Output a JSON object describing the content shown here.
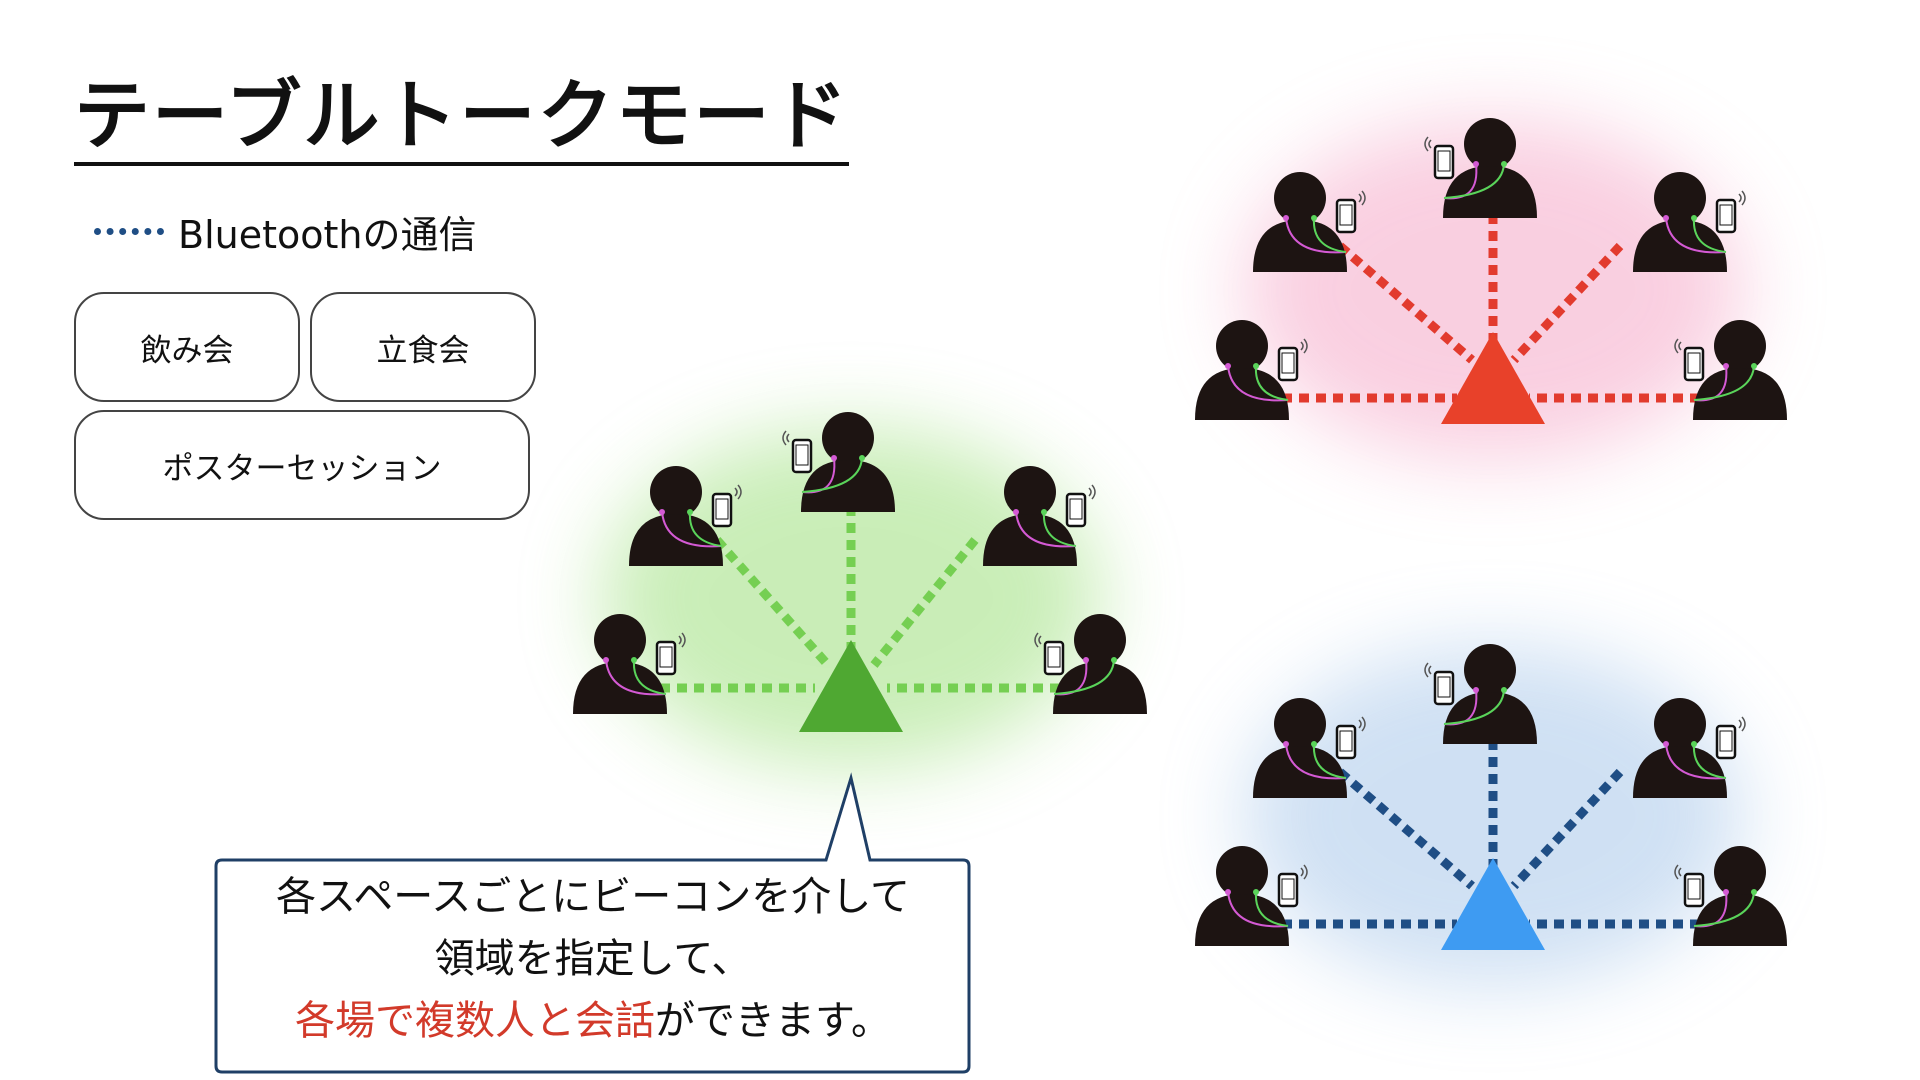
{
  "title": "テーブルトークモード",
  "legend": {
    "label": "Bluetoothの通信",
    "line_color": "#1f4e85"
  },
  "modes": [
    {
      "label": "飲み会"
    },
    {
      "label": "立食会"
    },
    {
      "label": "ポスターセッション"
    }
  ],
  "callout": {
    "line1": "各スペースごとにビーコンを介して",
    "line2": "領域を指定して、",
    "line3_highlight": "各場で複数人と会話",
    "line3_rest": "ができます。"
  },
  "clusters": [
    {
      "name": "green",
      "beacon_color": "#4fa832",
      "link_color": "#75cf52",
      "glow_color": "#9ee07e"
    },
    {
      "name": "red",
      "beacon_color": "#e8412a",
      "link_color": "#e23b2e",
      "glow_color": "#f5a8c8"
    },
    {
      "name": "blue",
      "beacon_color": "#3e9bf2",
      "link_color": "#1f4e85",
      "glow_color": "#a9c8ea"
    }
  ],
  "icons": {
    "person": "person-icon",
    "phone": "smartphone-icon",
    "earphone": "earphone-icon",
    "beacon": "beacon-triangle-icon"
  }
}
